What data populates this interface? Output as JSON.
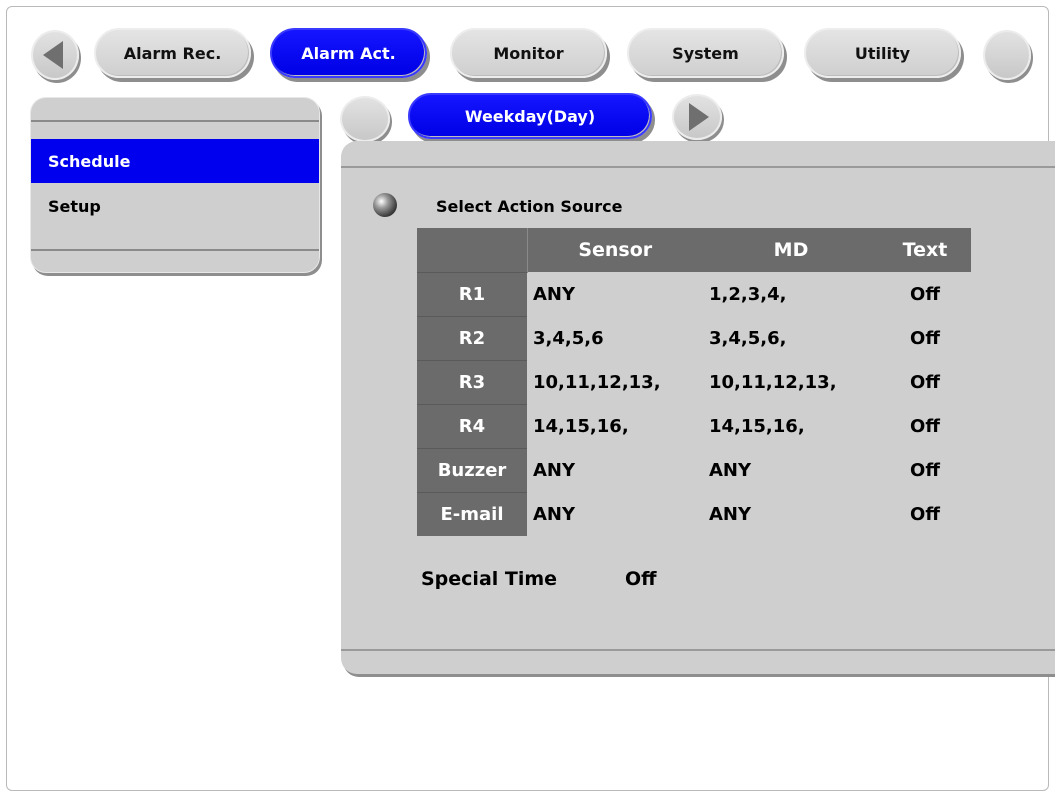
{
  "nav": {
    "tabs": [
      {
        "label": "Alarm Rec.",
        "active": false
      },
      {
        "label": "Alarm Act.",
        "active": true
      },
      {
        "label": "Monitor",
        "active": false
      },
      {
        "label": "System",
        "active": false
      },
      {
        "label": "Utility",
        "active": false
      }
    ]
  },
  "sub_nav": {
    "current_label": "Weekday(Day)"
  },
  "sidebar": {
    "items": [
      {
        "label": "Schedule",
        "selected": true
      },
      {
        "label": "Setup",
        "selected": false
      }
    ]
  },
  "main": {
    "section_title": "Select Action Source",
    "table": {
      "columns": [
        "Sensor",
        "MD",
        "Text"
      ],
      "rows": [
        {
          "label": "R1",
          "sensor": "ANY",
          "md": "1,2,3,4,",
          "text": "Off"
        },
        {
          "label": "R2",
          "sensor": "3,4,5,6",
          "md": "3,4,5,6,",
          "text": "Off"
        },
        {
          "label": "R3",
          "sensor": "10,11,12,13,",
          "md": "10,11,12,13,",
          "text": "Off"
        },
        {
          "label": "R4",
          "sensor": "14,15,16,",
          "md": "14,15,16,",
          "text": "Off"
        },
        {
          "label": "Buzzer",
          "sensor": "ANY",
          "md": "ANY",
          "text": "Off"
        },
        {
          "label": "E-mail",
          "sensor": "ANY",
          "md": "ANY",
          "text": "Off"
        }
      ]
    },
    "special_time": {
      "label": "Special Time",
      "value": "Off"
    }
  },
  "colors": {
    "accent": "#0000ee",
    "panel": "#cfcfcf",
    "table_header": "#6b6b6b"
  }
}
